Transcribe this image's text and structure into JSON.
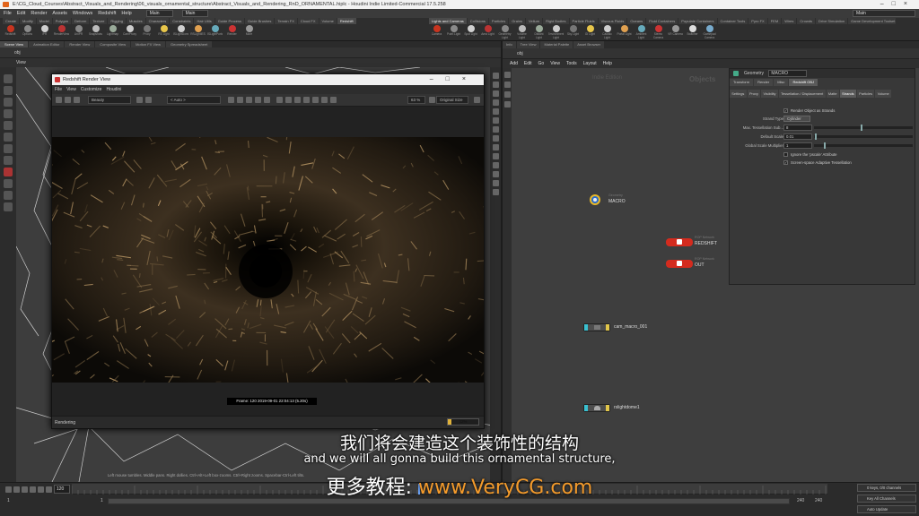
{
  "window": {
    "title": "E:\\CG_Cloud_Courses\\Abstract_Visuals_and_Rendering\\06_visuals_ornamental_structure\\Abstract_Visuals_and_Rendering_RnD_ORNAMENTAL.hiplc - Houdini Indie Limited-Commercial 17.5.258"
  },
  "menubar": {
    "items": [
      "File",
      "Edit",
      "Render",
      "Assets",
      "Windows",
      "Redshift",
      "Help"
    ],
    "desktop": "Main",
    "desktop_right": "Main",
    "build": "Main"
  },
  "left_shelf": {
    "tabs": [
      "Create",
      "Modify",
      "Model",
      "Polygon",
      "Deform",
      "Texture",
      "Rigging",
      "Muscles",
      "Characters",
      "Constraints",
      "Hair Utils",
      "Guide Process",
      "Guide Brushes",
      "Terrain FX",
      "Cloud FX",
      "Volume",
      "Redshift"
    ],
    "tools": [
      "Redshift",
      "Options",
      "IPR",
      "RenderView",
      "UnIPR",
      "Snapshots",
      "Lightmap",
      "CamProxy",
      "Proxy",
      "RS Light",
      "RSLightDome",
      "RSLightIES",
      "RSLightPortal",
      "Render",
      "More"
    ]
  },
  "right_shelf": {
    "tabs": [
      "Lights and Cameras",
      "Collisions",
      "Particles",
      "Grains",
      "Vellum",
      "Rigid Bodies",
      "Particle Fluids",
      "Viscous Fluids",
      "Oceans",
      "Fluid Containers",
      "Populate Containers",
      "Container Tools",
      "Pyro FX",
      "FEM",
      "Wires",
      "Crowds",
      "Drive Simulation",
      "Game Development Toolset"
    ],
    "tools": [
      "Camera",
      "Point Light",
      "Spot Light",
      "Area Light",
      "Geometry Light",
      "Volume Light",
      "Distant Light",
      "Environment Light",
      "Sky Light",
      "GI Light",
      "Caustic Light",
      "Portal Light",
      "Ambient Light",
      "Stereo Camera",
      "VR Camera",
      "Switcher",
      "Gamepad Camera"
    ]
  },
  "viewport": {
    "tabs": [
      "Scene View",
      "Animation Editor",
      "Render View",
      "Composite View",
      "Motion FX View",
      "Geometry Spreadsheet"
    ],
    "path": "obj",
    "label": "View"
  },
  "render_view": {
    "title": "Redshift Render View",
    "menu": [
      "File",
      "View",
      "Customize",
      "Houdini"
    ],
    "aov": "Beauty",
    "auto": "< Auto >",
    "zoom": "63 %",
    "size": "Original Size",
    "frame_info": "Frame: 120   2019-09-01  22:04:13   (5.20s)",
    "status": "Rendering",
    "progress_label": "12%",
    "progress": 0.12
  },
  "network": {
    "tabs": [
      "Info",
      "Tree View",
      "Material Palette",
      "Asset Browser"
    ],
    "path": "obj",
    "menu": [
      "Add",
      "Edit",
      "Go",
      "View",
      "Tools",
      "Layout",
      "Help"
    ],
    "watermark_left": "Indie Edition",
    "watermark_right": "Objects",
    "nodes": [
      {
        "type": "Geometry",
        "name": "MACRO"
      },
      {
        "type": "ROP Network",
        "name": "REDSHIFT"
      },
      {
        "type": "ROP Network",
        "name": "OUT"
      },
      {
        "type": "",
        "name": "cam_macro_001"
      },
      {
        "type": "",
        "name": "rslightdome1"
      }
    ]
  },
  "params": {
    "node_type": "Geometry",
    "node_name": "MACRO",
    "top_tabs": [
      "Transform",
      "Render",
      "Misc",
      "Redshift OBJ"
    ],
    "active_top_tab": 3,
    "sub_tabs": [
      "Settings",
      "Proxy",
      "Visibility",
      "Tessellation / Displacement",
      "Matte",
      "Strands",
      "Particles",
      "Volume"
    ],
    "active_sub_tab": 5,
    "render_as_strands": "Render Object as Strands",
    "strand_type_label": "Strand Type",
    "strand_type": "Cylinder",
    "max_tess_label": "Max. Tessellation Sub...",
    "max_tess": "8",
    "max_tess_level": 0.48,
    "default_scale_label": "Default Scale",
    "default_scale": "0.01",
    "default_scale_level": 0.01,
    "global_scale_label": "Global Scale Multiplier",
    "global_scale": "1",
    "global_scale_level": 0.1,
    "ignore_pscale": "Ignore the 'pscale' Attribute",
    "screen_space": "Screen-space Adaptive Tessellation"
  },
  "timeline": {
    "current_frame": "120",
    "range_start": "1",
    "range_start2": "1",
    "range_end": "240",
    "range_end2": "240",
    "status_line": "Left mouse tumbles. Middle pans. Right dollies. Ctrl+Alt+Left box-zooms. Ctrl+Right zooms. Spacebar-Ctrl-Left tilts.",
    "keys_label": "0 keys, 0/0 channels",
    "channels_label": "Key All Channels",
    "update_label": "Auto Update"
  },
  "subtitles": {
    "chinese": "我们将会建造这个装饰性的结构",
    "english": "and we will all gonna build this ornamental structure,",
    "watermark_prefix": "更多教程: ",
    "watermark_site": "www.VeryCG.com"
  },
  "colors": {
    "accent_orange": "#e2641b",
    "rop_red": "#d42b1e",
    "progress_gold": "#e0b23a",
    "watermark_orange": "#f39a2b"
  }
}
